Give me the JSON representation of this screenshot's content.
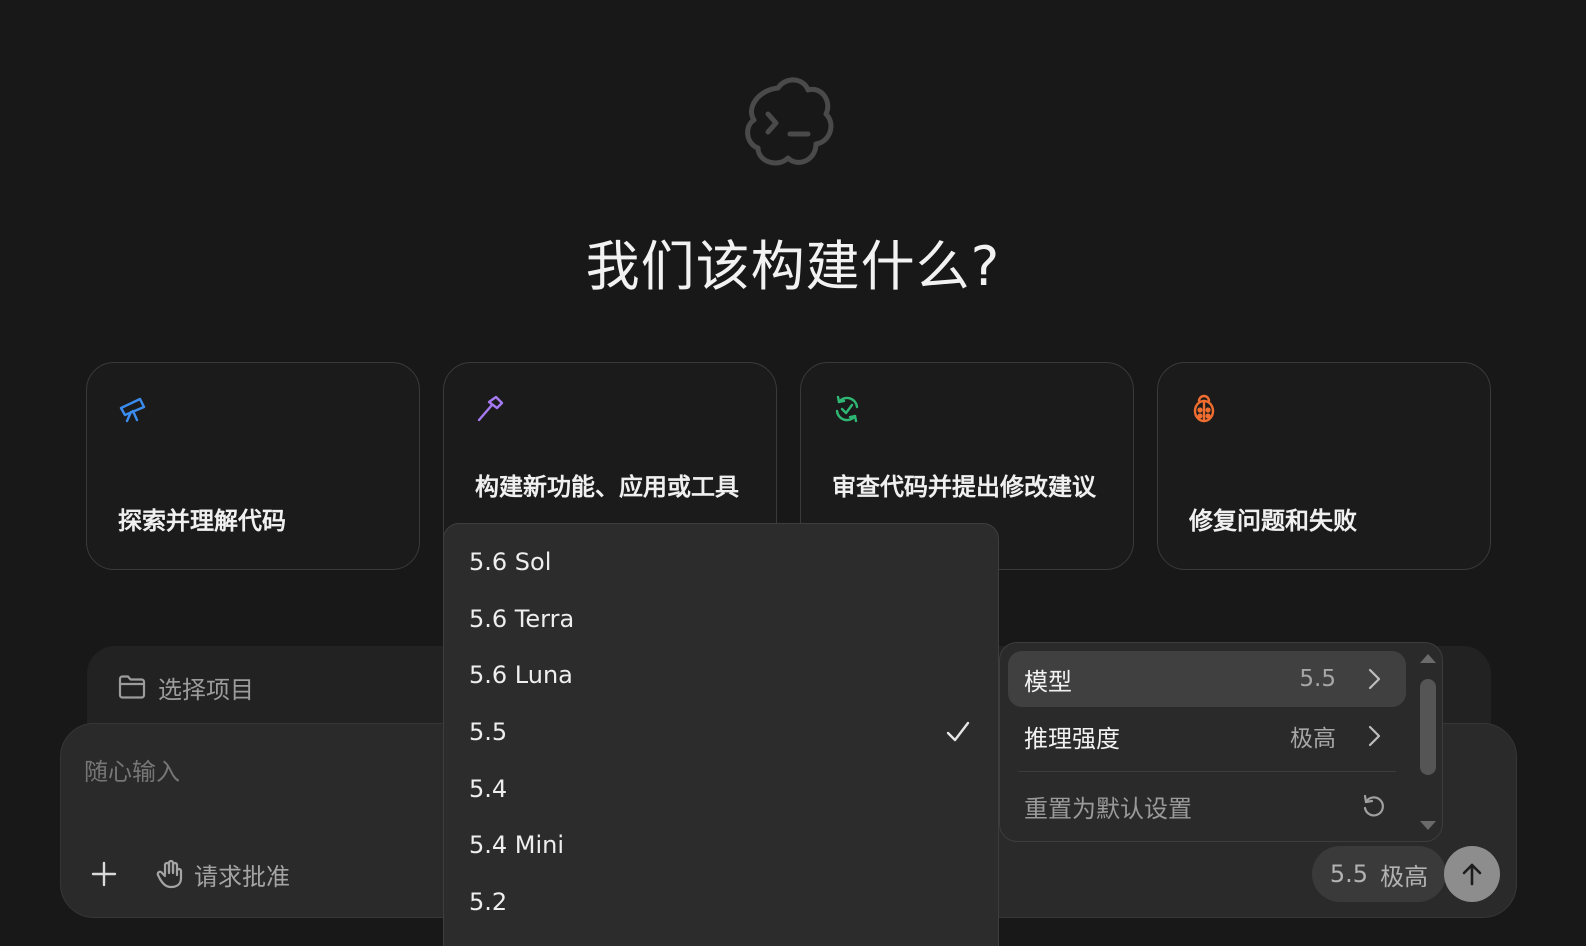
{
  "hero": {
    "title": "我们该构建什么?",
    "logo_icon": "terminal-cloud-icon"
  },
  "suggestions": [
    {
      "label": "探索并理解代码",
      "icon": "telescope-icon",
      "icon_color": "#3b8cf0"
    },
    {
      "label": "构建新功能、应用或工具",
      "icon": "hammer-icon",
      "icon_color": "#a57af2"
    },
    {
      "label": "审查代码并提出修改建议",
      "icon": "review-refresh-icon",
      "icon_color": "#2fb774"
    },
    {
      "label": "修复问题和失败",
      "icon": "bug-icon",
      "icon_color": "#ee6d2f"
    }
  ],
  "project": {
    "label": "选择项目",
    "icon": "folder-icon"
  },
  "composer": {
    "placeholder": "随心输入",
    "add_icon": "plus-icon",
    "approval_label": "请求批准",
    "approval_icon": "hand-icon",
    "model_value": "5.5",
    "effort_value": "极高",
    "send_icon": "arrow-up-icon"
  },
  "model_menu": {
    "items": [
      {
        "label": "5.6 Sol",
        "selected": false
      },
      {
        "label": "5.6 Terra",
        "selected": false
      },
      {
        "label": "5.6 Luna",
        "selected": false
      },
      {
        "label": "5.5",
        "selected": true
      },
      {
        "label": "5.4",
        "selected": false
      },
      {
        "label": "5.4 Mini",
        "selected": false
      },
      {
        "label": "5.2",
        "selected": false
      }
    ],
    "check_icon": "checkmark-icon"
  },
  "settings_menu": {
    "model": {
      "label": "模型",
      "value": "5.5"
    },
    "effort": {
      "label": "推理强度",
      "value": "极高"
    },
    "reset": {
      "label": "重置为默认设置",
      "icon": "reset-icon"
    }
  },
  "colors": {
    "background": "#181818",
    "surface": "#2a2a2a",
    "menu": "#2c2c2c",
    "menu_active": "#404040",
    "text": "#ececec",
    "muted": "#9a9a9a"
  }
}
